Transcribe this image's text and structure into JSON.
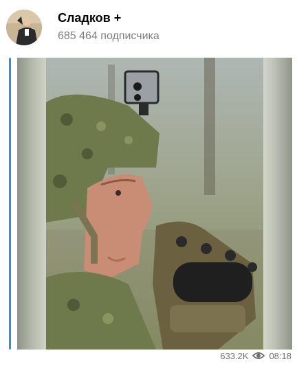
{
  "header": {
    "title": "Сладков +",
    "subscribers": "685 464 подписчика"
  },
  "post": {
    "views": "633.2K",
    "time": "08:18"
  },
  "icons": {
    "views": "eye-icon"
  },
  "colors": {
    "accent": "#3a8bd9",
    "background": "#d9e8c9"
  }
}
